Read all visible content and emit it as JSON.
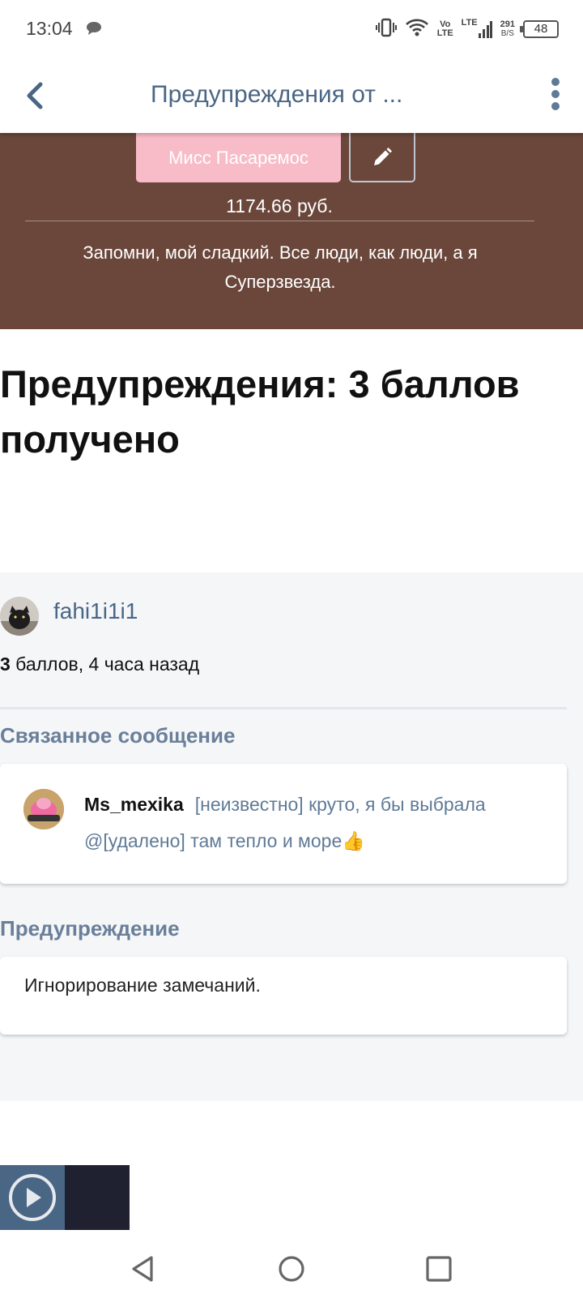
{
  "status_bar": {
    "time": "13:04",
    "net_volte_top": "Vo",
    "net_volte_bottom": "LTE",
    "net_lte": "LTE",
    "speed_top": "291",
    "speed_bottom": "B/S",
    "battery": "48"
  },
  "app_bar": {
    "title": "Предупреждения от ..."
  },
  "profile": {
    "name_button": "Мисс Пасаремос",
    "balance": "1174.66 руб.",
    "status_quote": "Запомни, мой сладкий. Все люди, как люди, а я Суперзвезда."
  },
  "page_title": "Предупреждения: 3 баллов получено",
  "warning_card": {
    "username": "fahi1i1i1",
    "points_value": "3",
    "points_text": " баллов, 4 часа назад",
    "related_heading": "Связанное сообщение",
    "message_author": "Ms_mexika",
    "message_text": "[неизвестно] круто, я бы выбрала @[удалено] там тепло и море👍",
    "warning_heading": "Предупреждение",
    "warning_text": "Игнорирование замечаний."
  },
  "colors": {
    "accent": "#4a6685",
    "profile_bg": "#6b473b",
    "name_button_bg": "#f8bcc8",
    "section_heading": "#6a7f99"
  }
}
